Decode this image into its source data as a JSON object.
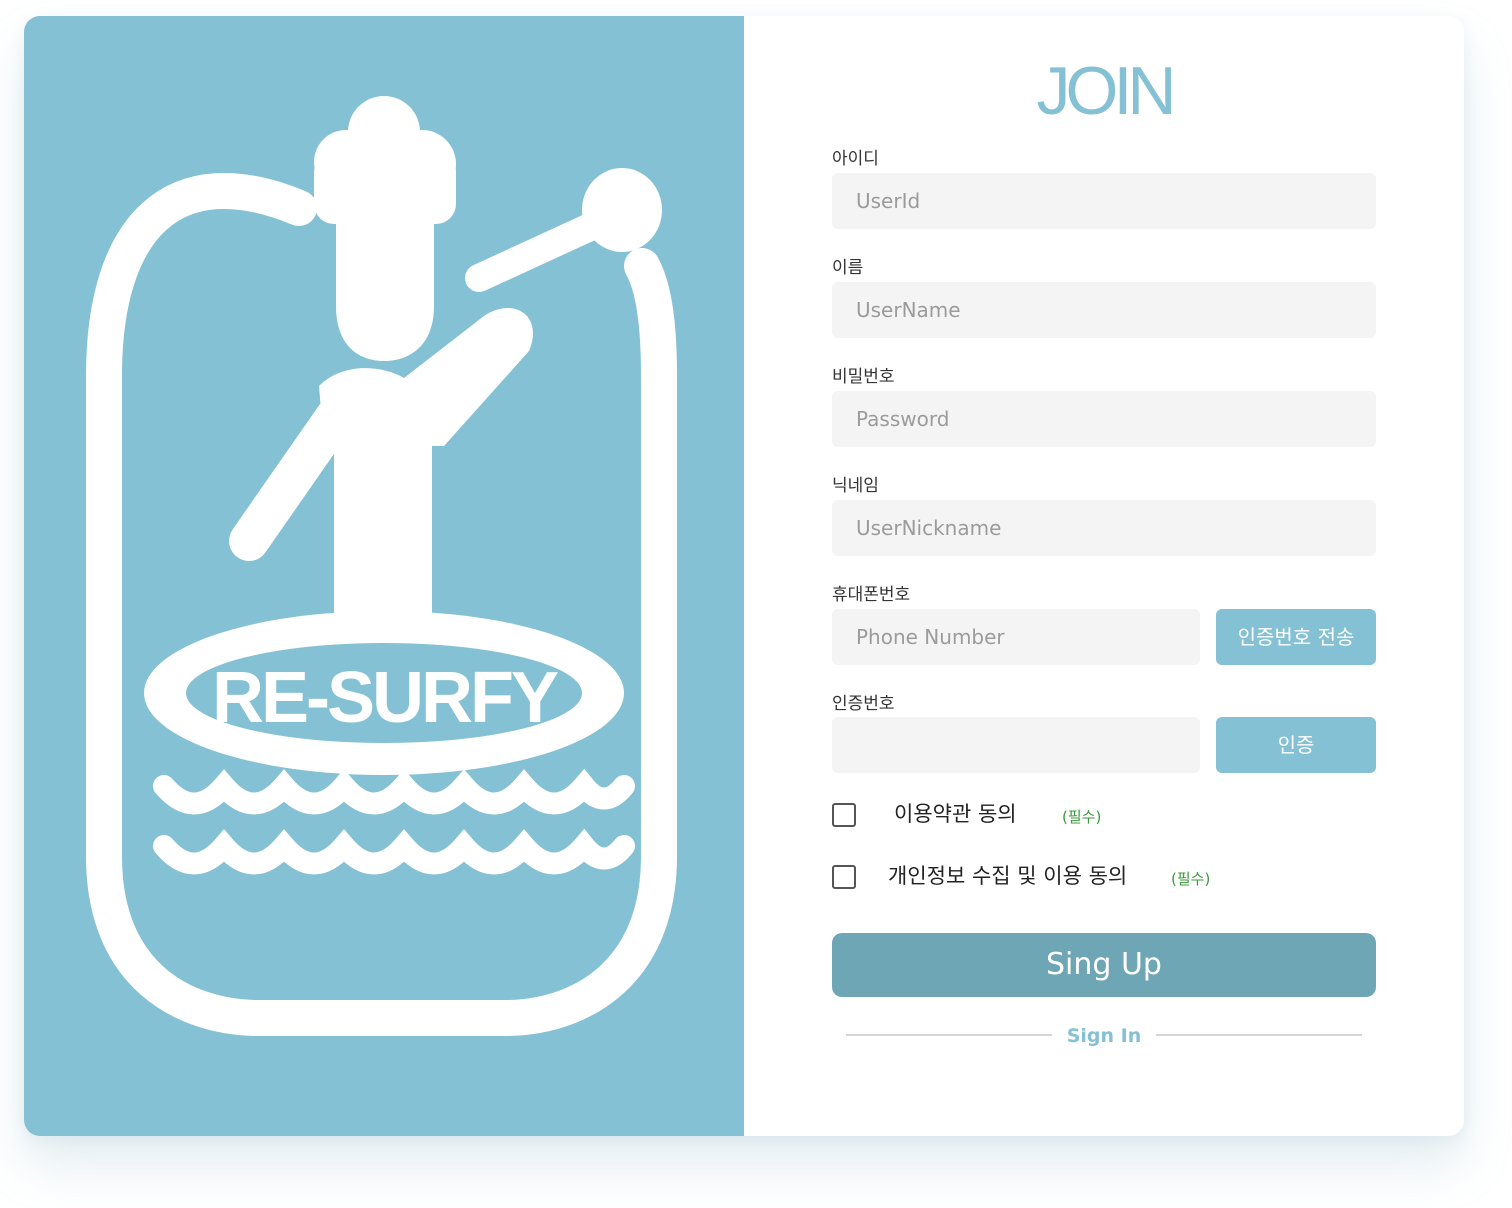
{
  "logo": {
    "text": "RE-SURFY",
    "colors": {
      "background": "#85c1d4",
      "foreground": "#ffffff"
    }
  },
  "form": {
    "title": "JOIN",
    "fields": [
      {
        "label": "아이디",
        "placeholder": "UserId",
        "value": ""
      },
      {
        "label": "이름",
        "placeholder": "UserName",
        "value": ""
      },
      {
        "label": "비밀번호",
        "placeholder": "Password",
        "value": ""
      },
      {
        "label": "닉네임",
        "placeholder": "UserNickname",
        "value": ""
      },
      {
        "label": "휴대폰번호",
        "placeholder": "Phone Number",
        "value": "",
        "button": "인증번호 전송"
      },
      {
        "label": "인증번호",
        "placeholder": "",
        "value": "",
        "button": "인증"
      }
    ],
    "agreements": [
      {
        "text": "이용약관 동의",
        "required": "(필수)",
        "checked": false
      },
      {
        "text": "개인정보 수집 및 이용 동의",
        "required": "(필수)",
        "checked": false
      }
    ],
    "submit_label": "Sing Up",
    "signin_label": "Sign In"
  },
  "colors": {
    "accent": "#85c1d4",
    "submit": "#6fa6b6",
    "required": "#3c9a3c",
    "input_bg": "#f4f4f4"
  }
}
